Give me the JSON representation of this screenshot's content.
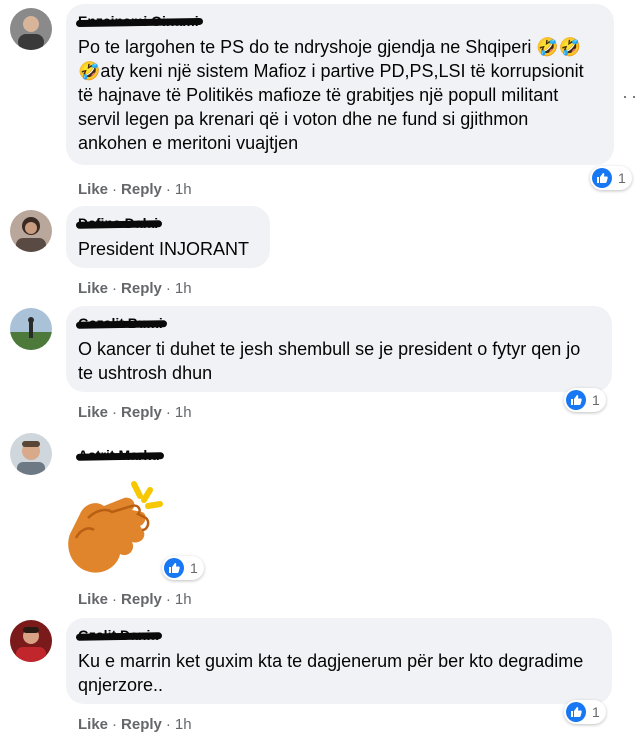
{
  "actions": {
    "like": "Like",
    "reply": "Reply",
    "separator": "·"
  },
  "comments": [
    {
      "author": "Enzeinami Oinami",
      "text": "Po te largohen te PS do te ndryshoje gjendja ne Shqiperi 🤣🤣🤣aty keni një sistem Mafioz i partive PD,PS,LSI të korrupsionit të hajnave të Politikës mafioze të grabitjes një popull militant servil legen pa krenari që i voton dhe ne fund si gjithmon ankohen e meritoni vuajtjen",
      "time": "1h",
      "reactions": "1"
    },
    {
      "author": "Dafina Dalai",
      "text": "President INJORANT",
      "time": "1h",
      "reactions": ""
    },
    {
      "author": "Gazalit Bumi",
      "text": "O kancer ti duhet te jesh shembull se je president o fytyr qen jo te ushtrosh dhun",
      "time": "1h",
      "reactions": "1"
    },
    {
      "author": "Astrit Marku",
      "sticker": "clapping-hands",
      "time": "1h",
      "reactions": "1"
    },
    {
      "author": "Gzalit Dania",
      "text": "Ku e marrin ket guxim kta te dagjenerum për ber kto degradime qnjerzore..",
      "time": "1h",
      "reactions": "1"
    }
  ],
  "colors": {
    "bubble": "#f0f2f5",
    "like_blue": "#1877f2",
    "meta_gray": "#65676b",
    "clap_orange": "#e0852b",
    "spark_yellow": "#f7c800"
  }
}
